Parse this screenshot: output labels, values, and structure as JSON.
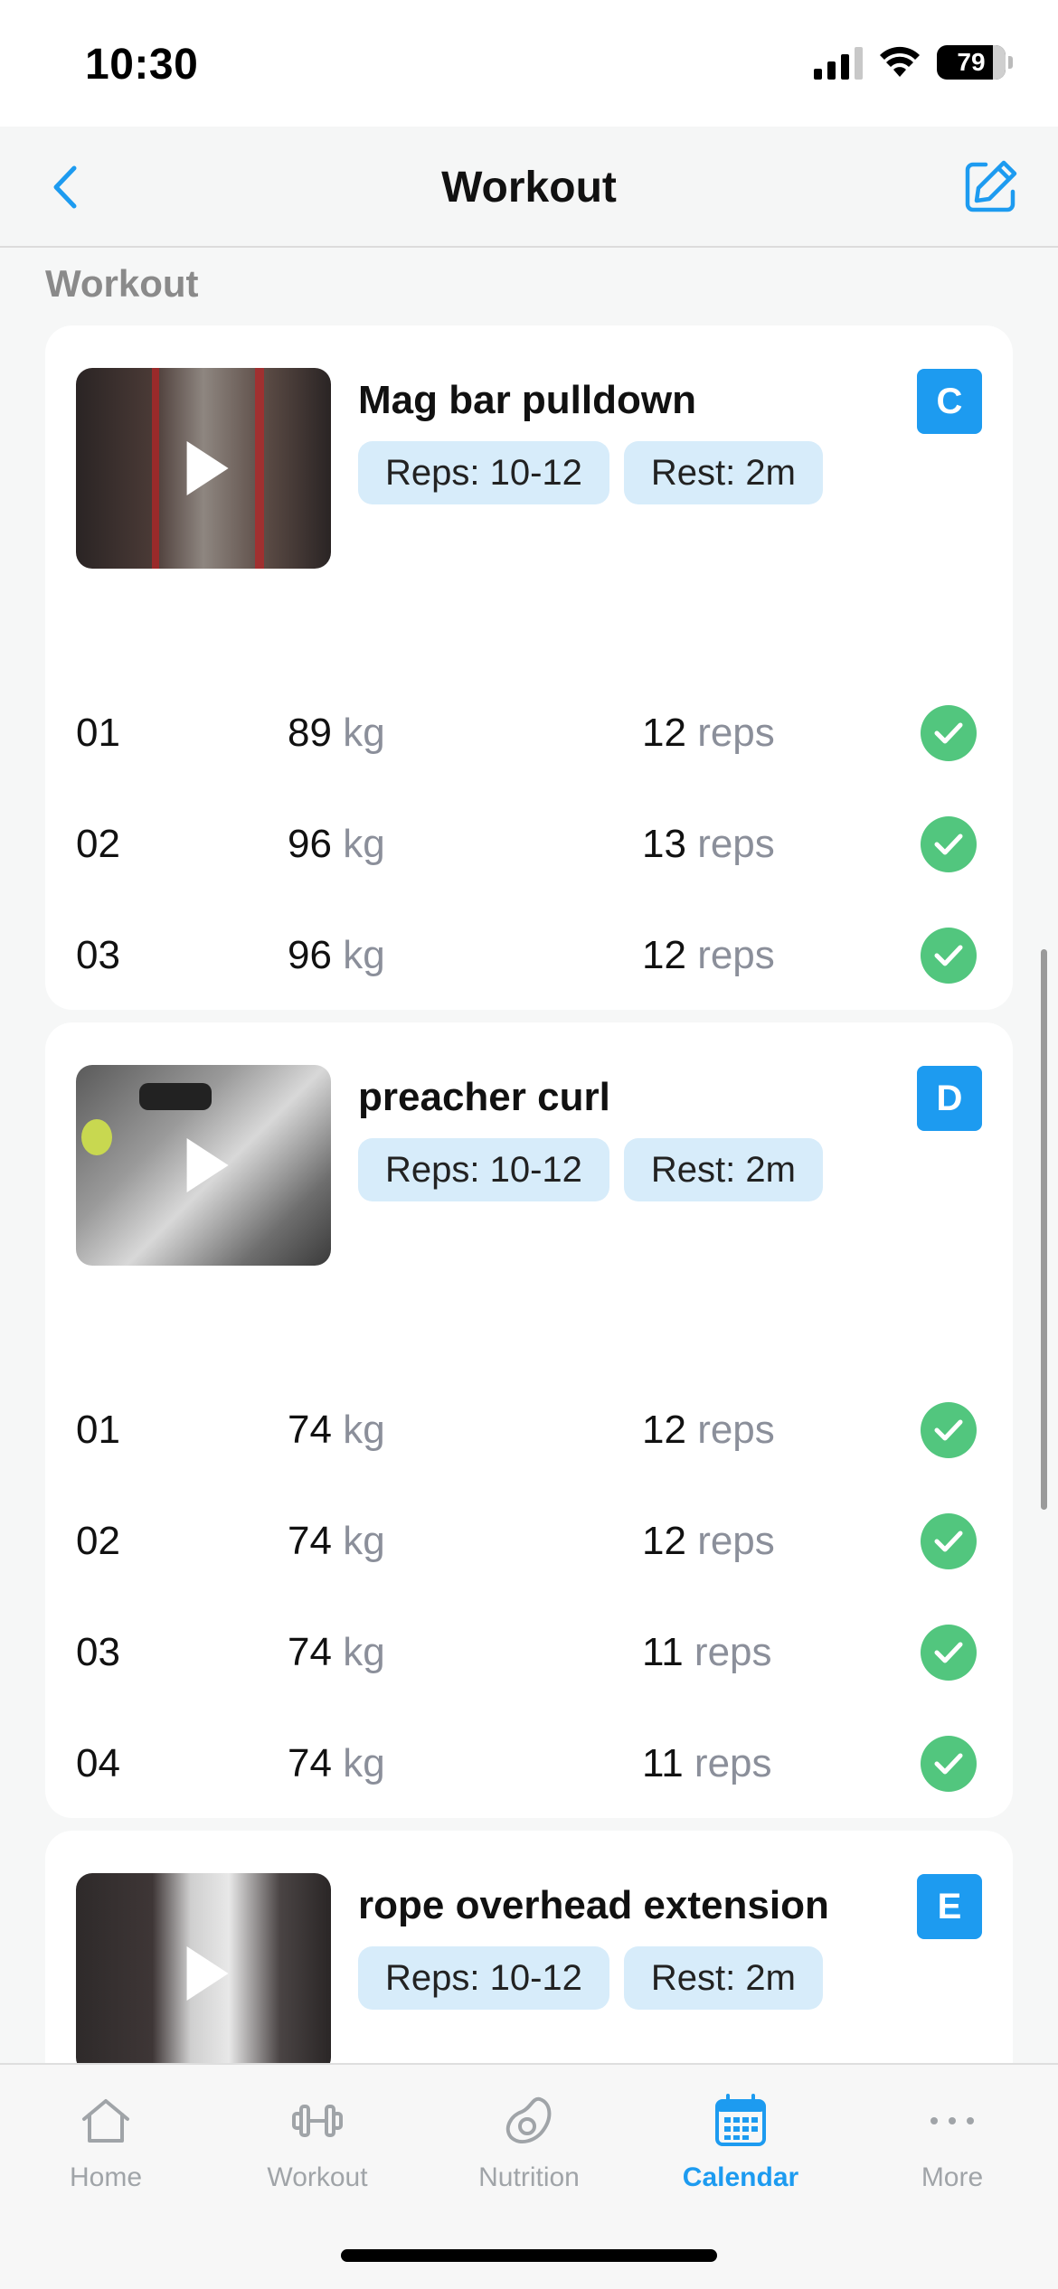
{
  "status_bar": {
    "time": "10:30",
    "battery": "79"
  },
  "nav": {
    "title": "Workout"
  },
  "section_label": "Workout",
  "exercises": [
    {
      "name": "Mag bar pulldown",
      "reps_badge": "Reps: 10-12",
      "rest_badge": "Rest: 2m",
      "letter": "C",
      "sets": [
        {
          "num": "01",
          "weight": "89",
          "weight_unit": "kg",
          "reps": "12",
          "reps_unit": "reps"
        },
        {
          "num": "02",
          "weight": "96",
          "weight_unit": "kg",
          "reps": "13",
          "reps_unit": "reps"
        },
        {
          "num": "03",
          "weight": "96",
          "weight_unit": "kg",
          "reps": "12",
          "reps_unit": "reps"
        }
      ]
    },
    {
      "name": "preacher curl",
      "reps_badge": "Reps: 10-12",
      "rest_badge": "Rest: 2m",
      "letter": "D",
      "sets": [
        {
          "num": "01",
          "weight": "74",
          "weight_unit": "kg",
          "reps": "12",
          "reps_unit": "reps"
        },
        {
          "num": "02",
          "weight": "74",
          "weight_unit": "kg",
          "reps": "12",
          "reps_unit": "reps"
        },
        {
          "num": "03",
          "weight": "74",
          "weight_unit": "kg",
          "reps": "11",
          "reps_unit": "reps"
        },
        {
          "num": "04",
          "weight": "74",
          "weight_unit": "kg",
          "reps": "11",
          "reps_unit": "reps"
        }
      ]
    },
    {
      "name": "rope overhead extension",
      "reps_badge": "Reps: 10-12",
      "rest_badge": "Rest: 2m",
      "letter": "E",
      "sets": []
    }
  ],
  "tabs": [
    {
      "label": "Home",
      "icon": "home-icon",
      "active": false
    },
    {
      "label": "Workout",
      "icon": "dumbbell-icon",
      "active": false
    },
    {
      "label": "Nutrition",
      "icon": "avocado-icon",
      "active": false
    },
    {
      "label": "Calendar",
      "icon": "calendar-icon",
      "active": true
    },
    {
      "label": "More",
      "icon": "more-icon",
      "active": false
    }
  ],
  "colors": {
    "accent": "#1d9bf0",
    "check_green": "#52c67e",
    "badge_bg": "#d7ecfa",
    "muted_text": "#8b8f9a"
  }
}
